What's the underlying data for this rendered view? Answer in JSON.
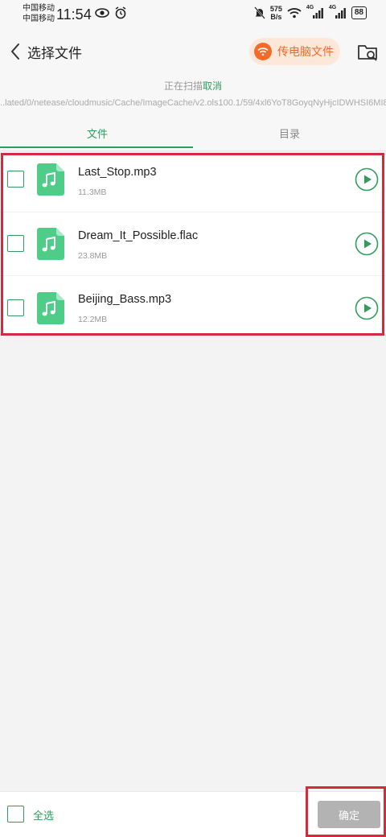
{
  "status_bar": {
    "carrier_1": "中国移动",
    "carrier_2": "中国移动",
    "time": "11:54",
    "net_speed_value": "575",
    "net_speed_unit": "B/s",
    "signal_1_label": "4G",
    "signal_2_label": "4G",
    "battery": "88"
  },
  "header": {
    "title": "选择文件",
    "pc_transfer_label": "传电脑文件"
  },
  "scan": {
    "status": "正在扫描",
    "cancel": "取消",
    "path": "..lated/0/netease/cloudmusic/Cache/ImageCache/v2.ols100.1/59/4xl6YoT8GoyqNyHjcIDWHSI6MI8"
  },
  "tabs": [
    {
      "label": "文件",
      "active": true
    },
    {
      "label": "目录",
      "active": false
    }
  ],
  "files": [
    {
      "name": "Last_Stop.mp3",
      "size": "11.3MB"
    },
    {
      "name": "Dream_It_Possible.flac",
      "size": "23.8MB"
    },
    {
      "name": "Beijing_Bass.mp3",
      "size": "12.2MB"
    }
  ],
  "bottom": {
    "select_all": "全选",
    "confirm": "确定"
  },
  "colors": {
    "accent_green": "#2e9d5a",
    "accent_orange": "#f36b2b",
    "highlight_red": "#d32b3b",
    "disabled_gray": "#b3b3b3"
  },
  "icons": {
    "back": "chevron-left-icon",
    "pc_transfer": "wifi-icon",
    "folder_search": "folder-search-icon",
    "file_type": "music-file-icon",
    "play": "play-circle-icon"
  }
}
